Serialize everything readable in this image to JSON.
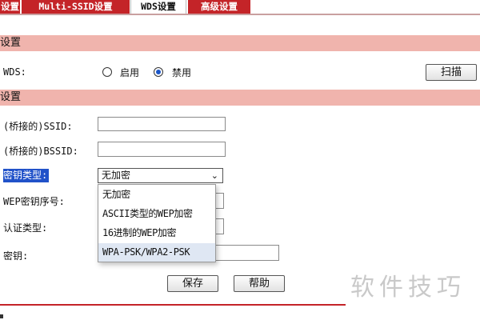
{
  "tabs": [
    {
      "label": "设置"
    },
    {
      "label": "Multi-SSID设置"
    },
    {
      "label": "WDS设置"
    },
    {
      "label": "高级设置"
    }
  ],
  "section1": {
    "title": "设置"
  },
  "wds": {
    "label": "WDS:",
    "options": [
      {
        "label": "启用",
        "checked": false
      },
      {
        "label": "禁用",
        "checked": true
      }
    ],
    "scan_label": "扫描"
  },
  "section2": {
    "title": "设置"
  },
  "form": {
    "ssid_label": "(桥接的)SSID:",
    "bssid_label": "(桥接的)BSSID:",
    "key_type_label": "密钥类型:",
    "key_type_value": "无加密",
    "wep_index_label": "WEP密钥序号:",
    "auth_type_label": "认证类型:",
    "key_label": "密钥:"
  },
  "dropdown": {
    "options": [
      "无加密",
      "ASCII类型的WEP加密",
      "16进制的WEP加密",
      "WPA-PSK/WPA2-PSK"
    ],
    "highlighted_index": 3
  },
  "buttons": {
    "save": "保存",
    "help": "帮助"
  },
  "watermark": "软件技巧",
  "colors": {
    "tab_red": "#c42428",
    "section_bg": "#f0b4ad",
    "selection_blue": "#2152c9"
  }
}
